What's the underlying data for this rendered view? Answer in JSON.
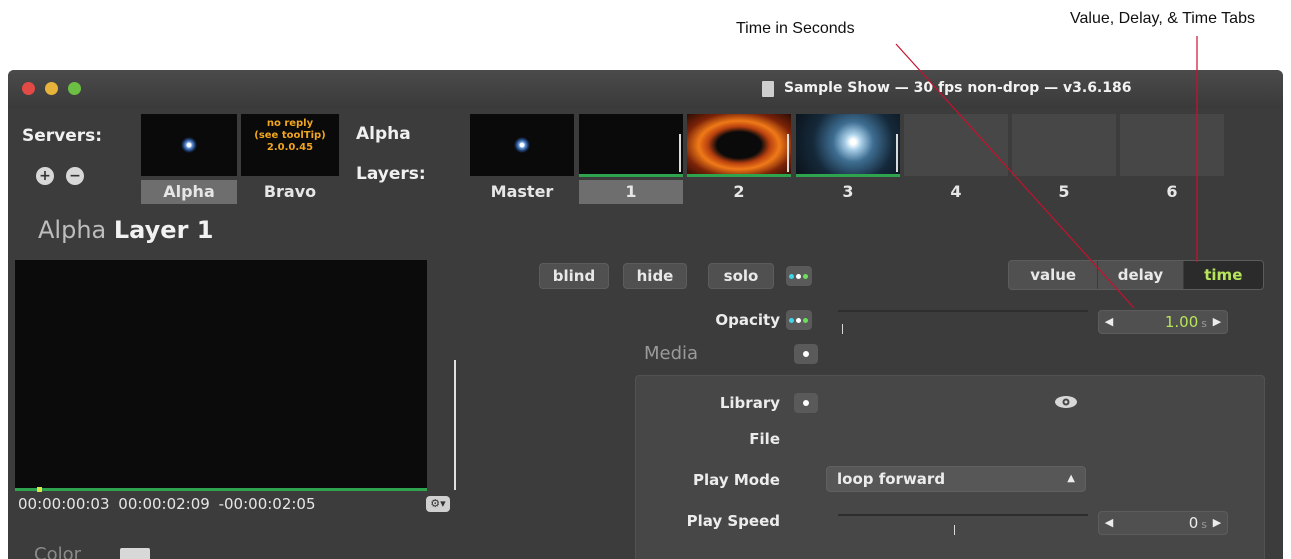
{
  "annotations": {
    "time_in_seconds": "Time in Seconds",
    "tabs_note": "Value, Delay, & Time Tabs"
  },
  "window": {
    "title": "Sample Show  —  30 fps non-drop  —  v3.6.186"
  },
  "servers": {
    "label": "Servers:",
    "add_icon": "plus-icon",
    "remove_icon": "minus-icon",
    "items": [
      {
        "name": "Alpha"
      },
      {
        "name": "Bravo",
        "status_lines": [
          "no reply",
          "(see toolTip)",
          "2.0.0.45"
        ]
      }
    ]
  },
  "layers": {
    "label_line1": "Alpha",
    "label_line2": "Layers:",
    "items": [
      "Master",
      "1",
      "2",
      "3",
      "4",
      "5",
      "6"
    ]
  },
  "header": {
    "server": "Alpha",
    "layer": "Layer 1"
  },
  "preview": {
    "timecode_elapsed": "00:00:00:03",
    "timecode_total": "00:00:02:09",
    "timecode_remaining": "-00:00:02:05",
    "options_icon": "gear-icon",
    "color_label": "Color"
  },
  "toggles": {
    "blind": "blind",
    "hide": "hide",
    "solo": "solo"
  },
  "tabs": {
    "value": "value",
    "delay": "delay",
    "time": "time",
    "active": "time"
  },
  "opacity": {
    "label": "Opacity",
    "value": "1.00",
    "unit": "s"
  },
  "media": {
    "section_label": "Media",
    "library_label": "Library",
    "file_label": "File",
    "play_mode_label": "Play Mode",
    "play_mode_value": "loop forward",
    "play_speed_label": "Play Speed",
    "play_speed_value": "0",
    "play_speed_unit": "s"
  },
  "colors": {
    "accent_green": "#b7e55a",
    "progress_green": "#2ea44f",
    "warning_orange": "#f0a51e",
    "callout_red": "#c8102e"
  }
}
